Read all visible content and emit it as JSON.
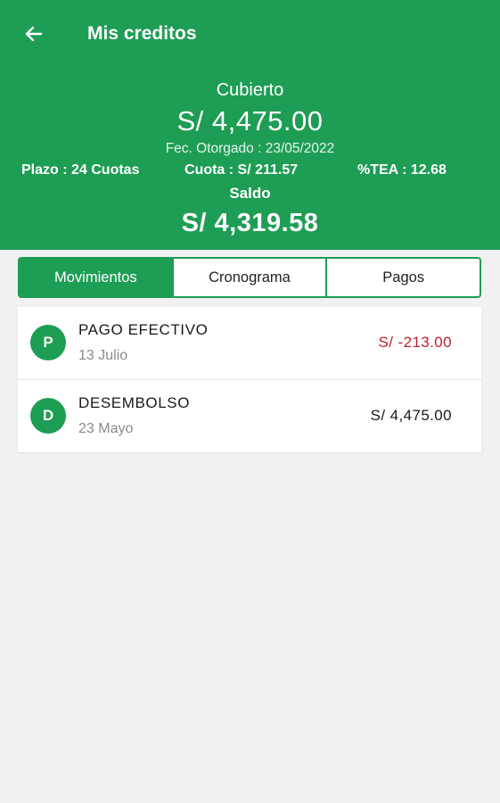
{
  "header": {
    "title": "Mis creditos",
    "back_icon": "arrow-left-icon",
    "background_color": "#1e9d55"
  },
  "summary": {
    "status": "Cubierto",
    "amount": "S/ 4,475.00",
    "granted_date": "Fec. Otorgado : 23/05/2022",
    "term": "Plazo : 24 Cuotas",
    "installment": "Cuota : S/ 211.57",
    "tea": "%TEA : 12.68",
    "balance_label": "Saldo",
    "balance_amount": "S/ 4,319.58"
  },
  "tabs": [
    {
      "label": "Movimientos",
      "active": true
    },
    {
      "label": "Cronograma",
      "active": false
    },
    {
      "label": "Pagos",
      "active": false
    }
  ],
  "movements": [
    {
      "badge": "P",
      "title": "PAGO EFECTIVO",
      "date": "13 Julio",
      "amount": "S/ -213.00",
      "amount_color": "#c0202a"
    },
    {
      "badge": "D",
      "title": "DESEMBOLSO",
      "date": "23 Mayo",
      "amount": "S/ 4,475.00",
      "amount_color": "#1a1a1a"
    }
  ]
}
